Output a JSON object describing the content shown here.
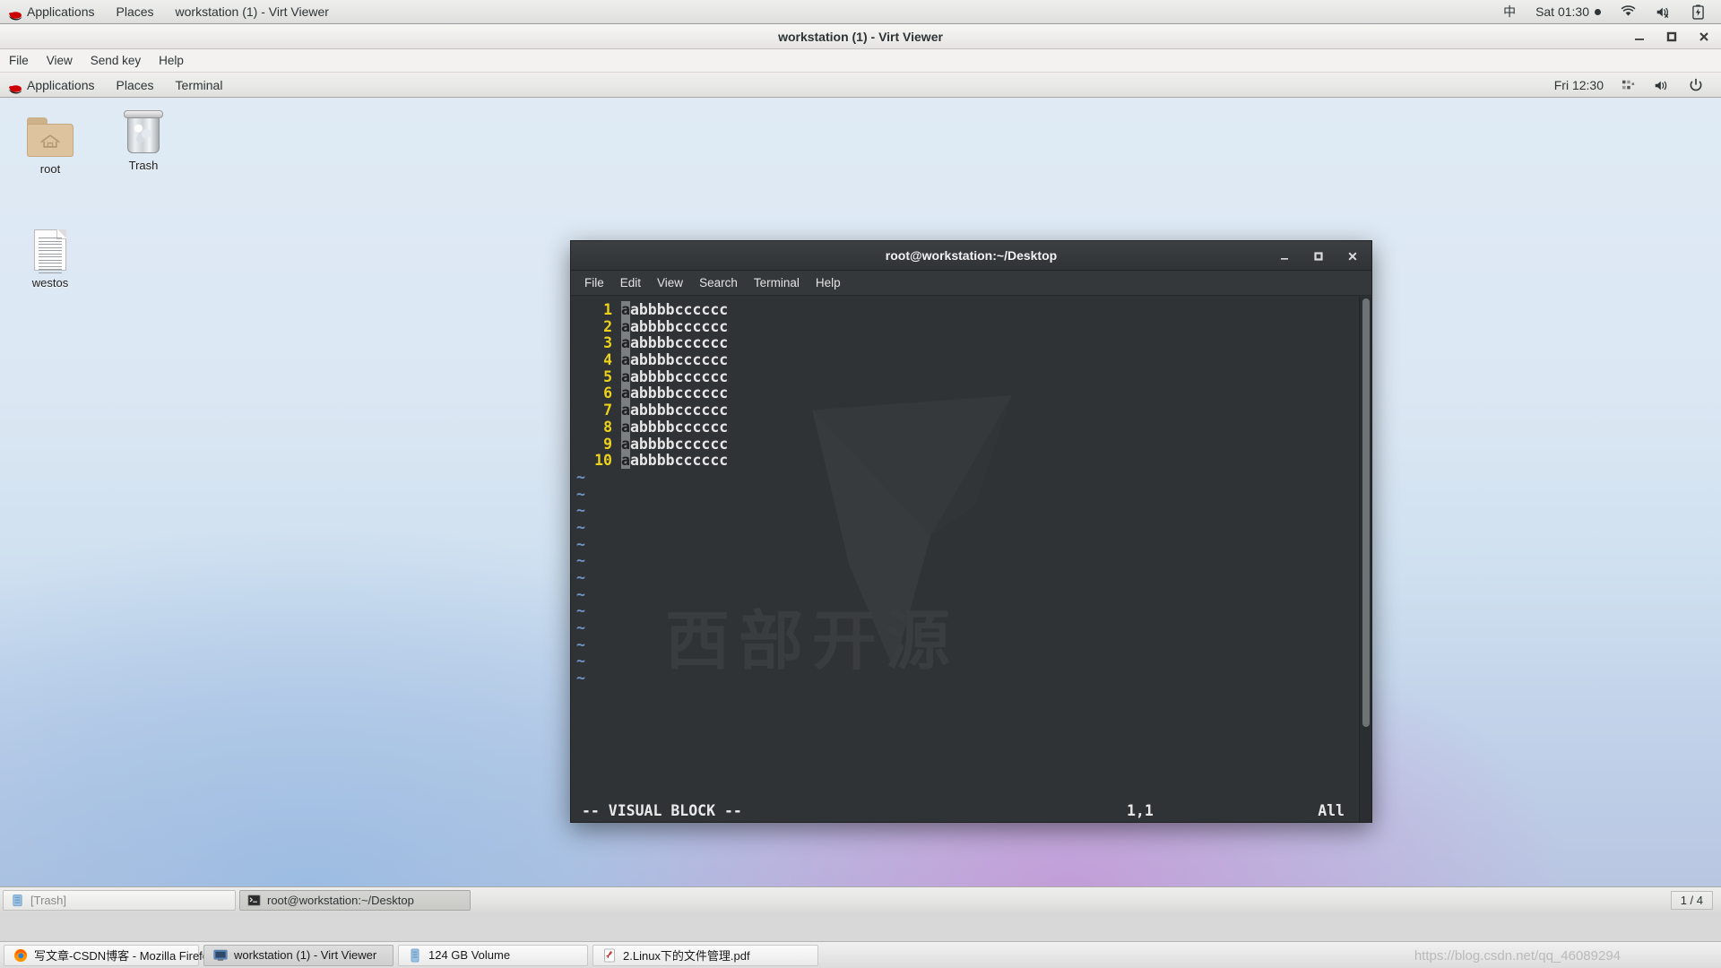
{
  "host_panel": {
    "logo": "redhat-logo",
    "items": [
      {
        "label": "Applications"
      },
      {
        "label": "Places"
      },
      {
        "label": "workstation (1) - Virt Viewer"
      }
    ],
    "tray": {
      "ime": "中",
      "clock": "Sat 01:30",
      "wifi_icon": "wifi-icon",
      "volume_icon": "volume-muted-icon",
      "battery_icon": "battery-charging-icon"
    }
  },
  "virt_viewer": {
    "title": "workstation (1) - Virt Viewer",
    "menu": [
      "File",
      "View",
      "Send key",
      "Help"
    ],
    "window_buttons": [
      "minimize",
      "maximize",
      "close"
    ]
  },
  "guest_panel": {
    "logo": "redhat-logo",
    "items": [
      {
        "label": "Applications"
      },
      {
        "label": "Places"
      },
      {
        "label": "Terminal"
      }
    ],
    "tray": {
      "clock": "Fri 12:30",
      "network_icon": "network-icon",
      "volume_icon": "volume-icon",
      "power_icon": "power-icon"
    }
  },
  "desktop": {
    "icons": [
      {
        "name": "root",
        "label": "root",
        "type": "home-folder"
      },
      {
        "name": "trash",
        "label": "Trash",
        "type": "trash"
      },
      {
        "name": "westos",
        "label": "westos",
        "type": "document"
      }
    ]
  },
  "terminal": {
    "title": "root@workstation:~/Desktop",
    "menu": [
      "File",
      "Edit",
      "View",
      "Search",
      "Terminal",
      "Help"
    ],
    "window_buttons": [
      "minimize",
      "maximize",
      "close"
    ],
    "watermark_text": "西部开源",
    "vim": {
      "lines": [
        {
          "num": "1",
          "selected": "a",
          "rest": "abbbbcccccc"
        },
        {
          "num": "2",
          "selected": "a",
          "rest": "abbbbcccccc"
        },
        {
          "num": "3",
          "selected": "a",
          "rest": "abbbbcccccc"
        },
        {
          "num": "4",
          "selected": "a",
          "rest": "abbbbcccccc"
        },
        {
          "num": "5",
          "selected": "a",
          "rest": "abbbbcccccc"
        },
        {
          "num": "6",
          "selected": "a",
          "rest": "abbbbcccccc"
        },
        {
          "num": "7",
          "selected": "a",
          "rest": "abbbbcccccc"
        },
        {
          "num": "8",
          "selected": "a",
          "rest": "abbbbcccccc"
        },
        {
          "num": "9",
          "selected": "a",
          "rest": "abbbbcccccc"
        },
        {
          "num": "10",
          "selected": "a",
          "rest": "abbbbcccccc"
        }
      ],
      "tilde_count": 13,
      "status": {
        "mode": "-- VISUAL BLOCK --",
        "position": "1,1",
        "scroll": "All"
      }
    }
  },
  "guest_taskbar": {
    "items": [
      {
        "label": "[Trash]",
        "icon": "trash-icon",
        "state": "minimized"
      },
      {
        "label": "root@workstation:~/Desktop",
        "icon": "terminal-icon",
        "state": "active"
      }
    ],
    "workspace": "1 / 4"
  },
  "host_taskbar": {
    "items": [
      {
        "label": "写文章-CSDN博客 - Mozilla Firefox",
        "icon": "firefox-icon",
        "state": "normal"
      },
      {
        "label": "workstation (1) - Virt Viewer",
        "icon": "virt-viewer-icon",
        "state": "active"
      },
      {
        "label": "124 GB Volume",
        "icon": "drive-icon",
        "state": "normal"
      },
      {
        "label": "2.Linux下的文件管理.pdf",
        "icon": "pdf-icon",
        "state": "normal"
      }
    ],
    "watermark": "https://blog.csdn.net/qq_46089294"
  }
}
